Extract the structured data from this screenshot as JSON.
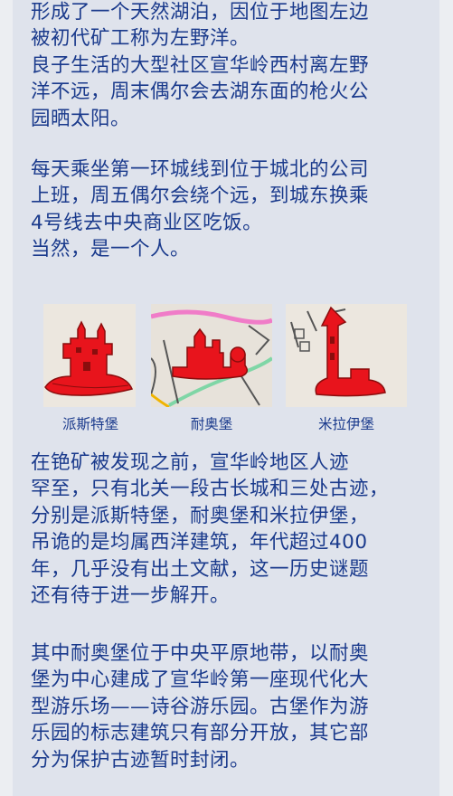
{
  "article": {
    "para1": [
      "形成了一个天然湖泊，因位于地图左边",
      "被初代矿工称为左野洋。",
      "良子生活的大型社区宣华岭西村离左野",
      "洋不远，周末偶尔会去湖东面的枪火公",
      "园晒太阳。"
    ],
    "para2": [
      "每天乘坐第一环城线到位于城北的公司",
      "上班，周五偶尔会绕个远，到城东换乘",
      "4号线去中央商业区吃饭。",
      "当然，是一个人。"
    ],
    "para3": [
      "在铯矿被发现之前，宣华岭地区人迹",
      "罕至，只有北关一段古长城和三处古迹，",
      "分别是派斯特堡，耐奥堡和米拉伊堡，",
      "吊诡的是均属西洋建筑，年代超过400",
      "年，几乎没有出土文献，这一历史谜题",
      "还有待于进一步解开。"
    ],
    "para4": [
      "其中耐奥堡位于中央平原地带，以耐奥",
      "堡为中心建成了宣华岭第一座现代化大",
      "型游乐场——诗谷游乐园。古堡作为游",
      "乐园的标志建筑只有部分开放，其它部",
      "分为保护古迹暂时封闭。"
    ]
  },
  "gallery": {
    "captions": [
      "派斯特堡",
      "耐奥堡",
      "米拉伊堡"
    ]
  },
  "colors": {
    "text": "#1a3a8c",
    "card_bg": "#dfe3ec",
    "castle_red": "#e8141c"
  }
}
